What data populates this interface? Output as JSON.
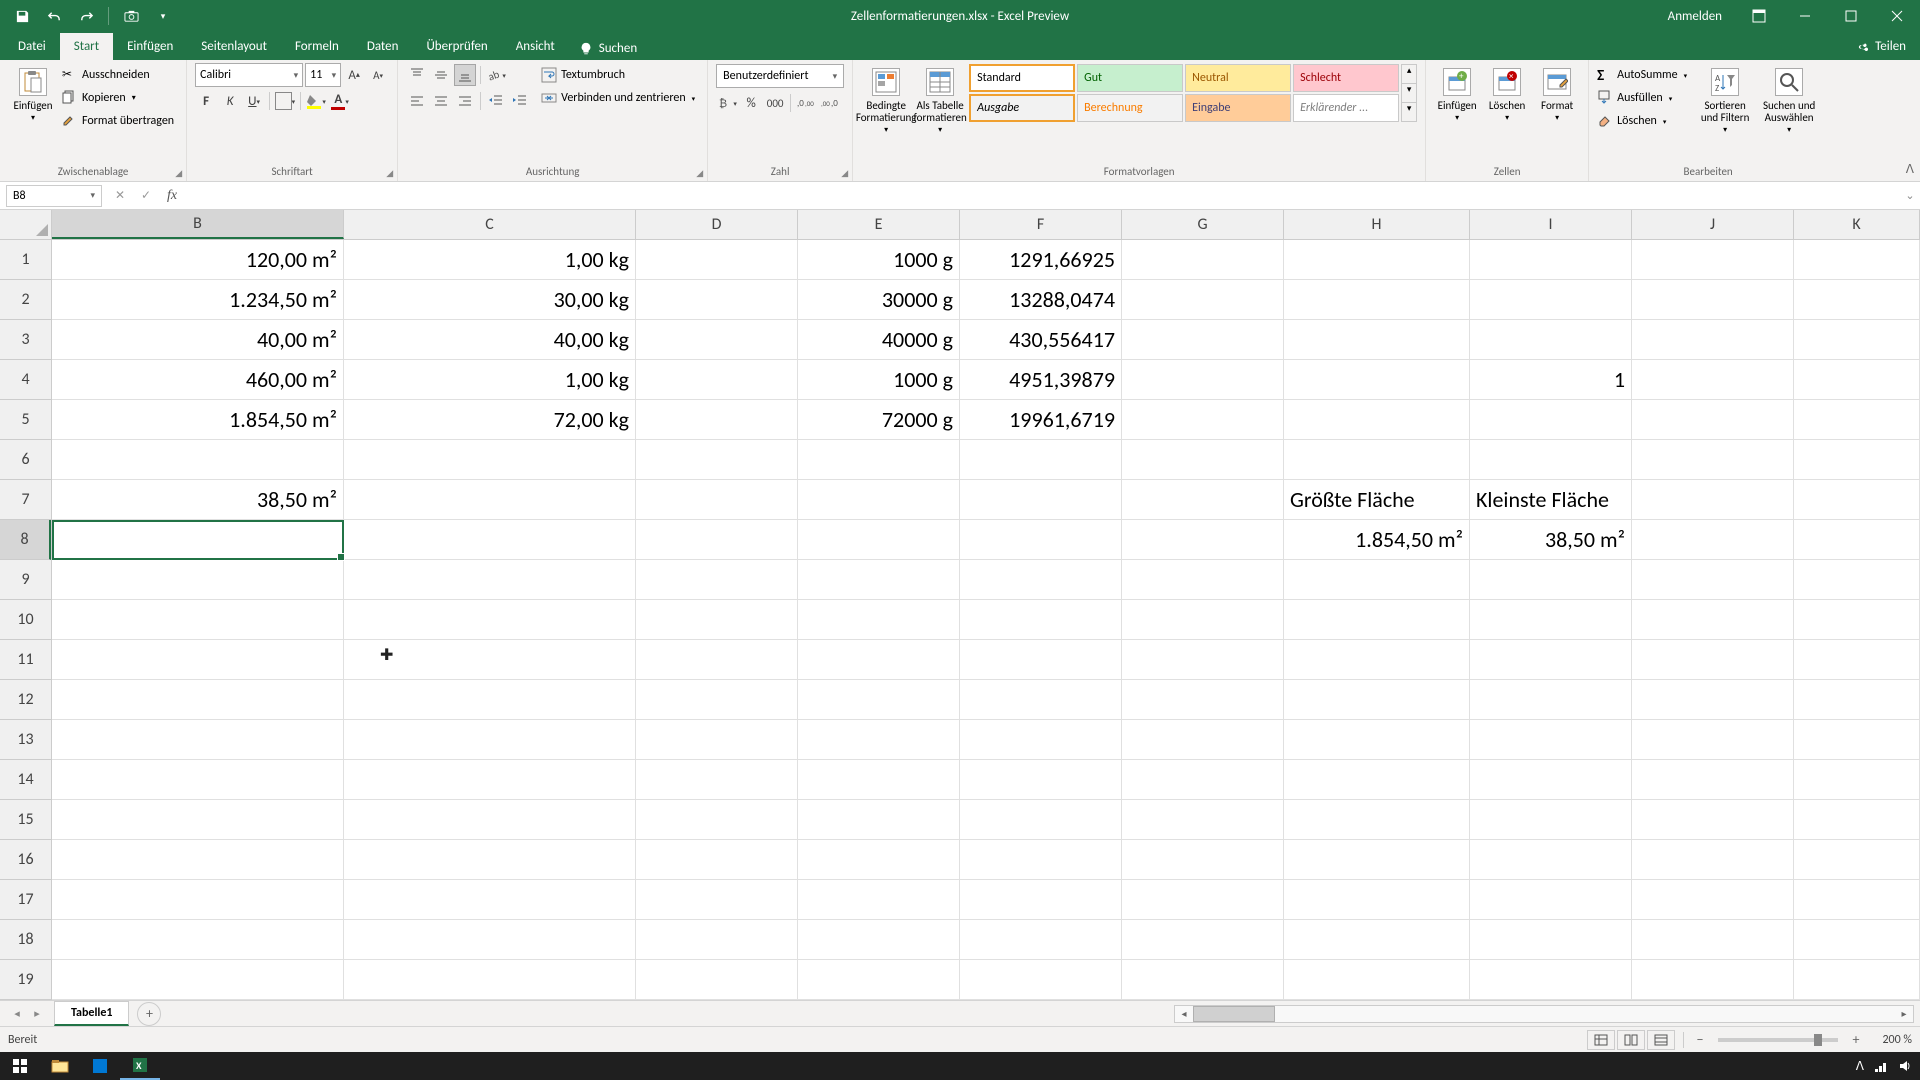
{
  "titlebar": {
    "title": "Zellenformatierungen.xlsx - Excel Preview",
    "signin": "Anmelden"
  },
  "tabs": {
    "datei": "Datei",
    "start": "Start",
    "einfuegen": "Einfügen",
    "seitenlayout": "Seitenlayout",
    "formeln": "Formeln",
    "daten": "Daten",
    "ueberpruefen": "Überprüfen",
    "ansicht": "Ansicht",
    "suchen": "Suchen",
    "teilen": "Teilen"
  },
  "ribbon": {
    "clipboard": {
      "paste": "Einfügen",
      "cut": "Ausschneiden",
      "copy": "Kopieren",
      "formatpainter": "Format übertragen",
      "group": "Zwischenablage"
    },
    "font": {
      "name": "Calibri",
      "size": "11",
      "group": "Schriftart"
    },
    "alignment": {
      "wrap": "Textumbruch",
      "merge": "Verbinden und zentrieren",
      "group": "Ausrichtung"
    },
    "number": {
      "format": "Benutzerdefiniert",
      "group": "Zahl"
    },
    "styles": {
      "cond": "Bedingte Formatierung",
      "table": "Als Tabelle formatieren",
      "standard": "Standard",
      "gut": "Gut",
      "neutral": "Neutral",
      "schlecht": "Schlecht",
      "ausgabe": "Ausgabe",
      "berechnung": "Berechnung",
      "eingabe": "Eingabe",
      "erklaerend": "Erklärender ...",
      "group": "Formatvorlagen"
    },
    "cells": {
      "insert": "Einfügen",
      "delete": "Löschen",
      "format": "Format",
      "group": "Zellen"
    },
    "editing": {
      "autosum": "AutoSumme",
      "fill": "Ausfüllen",
      "clear": "Löschen",
      "sort": "Sortieren und Filtern",
      "find": "Suchen und Auswählen",
      "group": "Bearbeiten"
    }
  },
  "formula": {
    "namebox": "B8",
    "value": ""
  },
  "columns": [
    "B",
    "C",
    "D",
    "E",
    "F",
    "G",
    "H",
    "I",
    "J",
    "K"
  ],
  "rows": [
    "1",
    "2",
    "3",
    "4",
    "5",
    "6",
    "7",
    "8",
    "9",
    "10",
    "11",
    "12",
    "13",
    "14",
    "15",
    "16",
    "17",
    "18",
    "19"
  ],
  "data": {
    "r1": {
      "B": "120,00 m²",
      "C": "1,00 kg",
      "E": "1000 g",
      "F": "1291,66925"
    },
    "r2": {
      "B": "1.234,50 m²",
      "C": "30,00 kg",
      "E": "30000 g",
      "F": "13288,0474"
    },
    "r3": {
      "B": "40,00 m²",
      "C": "40,00 kg",
      "E": "40000 g",
      "F": "430,556417"
    },
    "r4": {
      "B": "460,00 m²",
      "C": "1,00 kg",
      "E": "1000 g",
      "F": "4951,39879",
      "I": "1"
    },
    "r5": {
      "B": "1.854,50 m²",
      "C": "72,00 kg",
      "E": "72000 g",
      "F": "19961,6719"
    },
    "r7": {
      "B": "38,50 m²",
      "H": "Größte Fläche",
      "I": "Kleinste Fläche"
    },
    "r8": {
      "H": "1.854,50 m²",
      "I": "38,50 m²"
    }
  },
  "sheet": {
    "tab1": "Tabelle1"
  },
  "status": {
    "ready": "Bereit",
    "zoom": "200 %"
  },
  "selected_cell": "B8",
  "selected_col": "B",
  "selected_row": "8"
}
